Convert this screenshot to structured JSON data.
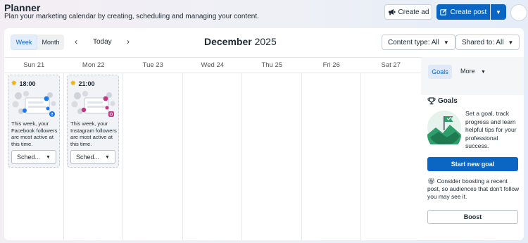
{
  "header": {
    "title": "Planner",
    "subtitle": "Plan your marketing calendar by creating, scheduling and managing your content.",
    "create_ad_label": "Create ad",
    "create_post_label": "Create post"
  },
  "toolbar": {
    "view_week": "Week",
    "view_month": "Month",
    "active_view": "Week",
    "prev_icon": "chevron-left-icon",
    "next_icon": "chevron-right-icon",
    "today_label": "Today",
    "month": "December",
    "year": "2025",
    "content_type_filter": "Content type: All",
    "shared_to_filter": "Shared to: All"
  },
  "calendar": {
    "days": [
      {
        "label": "Sun 21"
      },
      {
        "label": "Mon 22"
      },
      {
        "label": "Tue 23"
      },
      {
        "label": "Wed 24"
      },
      {
        "label": "Thu 25"
      },
      {
        "label": "Fri 26"
      },
      {
        "label": "Sat 27"
      }
    ],
    "suggestions": [
      {
        "time": "18:00",
        "platform": "facebook",
        "text": "This week, your Facebook followers are most active at this time.",
        "button_label": "Sched..."
      },
      {
        "time": "21:00",
        "platform": "instagram",
        "text": "This week, your Instagram followers are most active at this time.",
        "button_label": "Sched..."
      }
    ]
  },
  "side_panel": {
    "tab_goals": "Goals",
    "tab_more": "More",
    "goals_title": "Goals",
    "goals_description": "Set a goal, track progress and learn helpful tips for your professional success.",
    "start_goal_label": "Start new goal",
    "boost_description": "Consider boosting a recent post, so audiences that don't follow you may see it.",
    "boost_label": "Boost"
  },
  "colors": {
    "primary": "#0a66c2",
    "facebook": "#1877f2",
    "instagram": "#c13584",
    "sun": "#f5b400",
    "goal_green": "#2e9e6b"
  }
}
